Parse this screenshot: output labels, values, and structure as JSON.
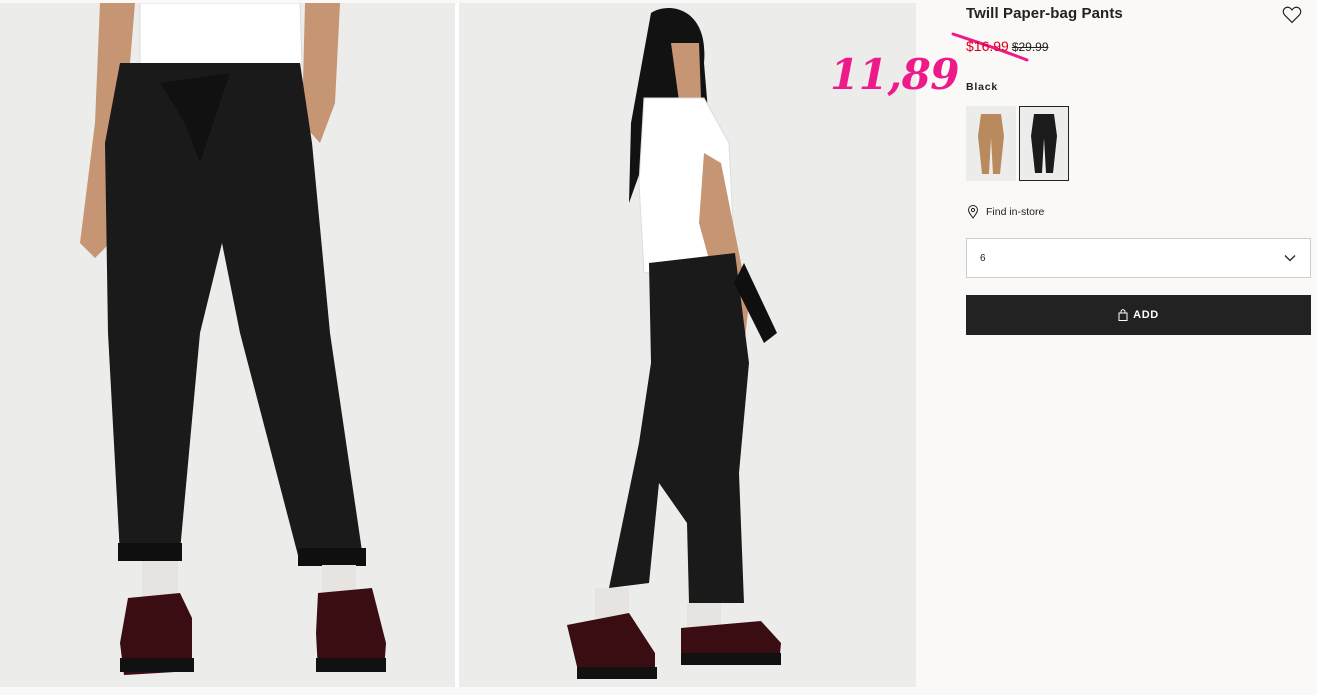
{
  "product": {
    "title": "Twill Paper-bag Pants",
    "sale_price": "$16.99",
    "original_price": "$29.99",
    "color_label": "Black",
    "handwritten_price": "11,89"
  },
  "colors": {
    "sale": "#d6001c",
    "handwriting": "#ee1a8a",
    "button": "#222222",
    "swatch_beige": "#b98a5d",
    "swatch_black": "#1b1b1b"
  },
  "store": {
    "label": "Find in-store"
  },
  "size": {
    "selected": "6"
  },
  "cart": {
    "add_label": "ADD"
  },
  "icons": [
    "heart-icon",
    "location-pin-icon",
    "chevron-down-icon",
    "shopping-bag-icon"
  ]
}
